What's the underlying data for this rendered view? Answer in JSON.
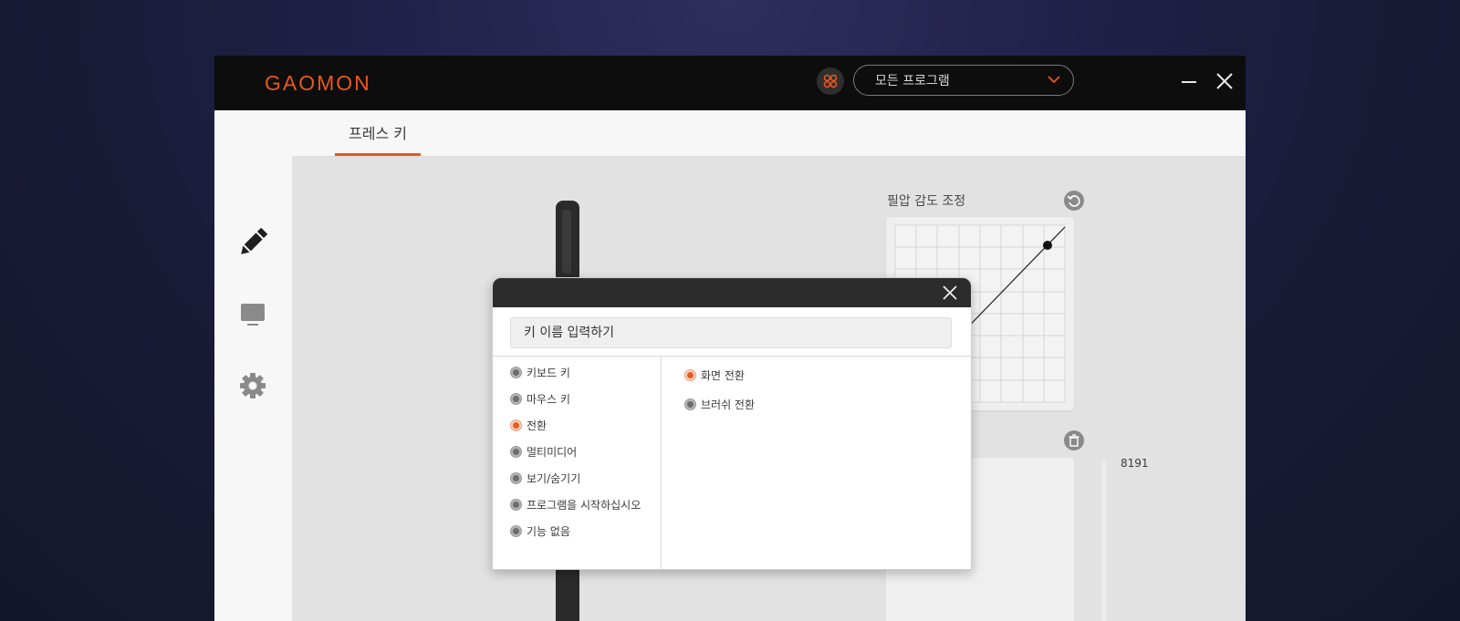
{
  "app": {
    "logo_text": "GAOMON",
    "program_select": "모든 프로그램",
    "accent_color": "#e8581c"
  },
  "tabs": [
    {
      "label": "프레스 키",
      "active": true
    }
  ],
  "sidebar": [
    {
      "icon": "pen-icon",
      "active": true
    },
    {
      "icon": "monitor-icon",
      "active": false
    },
    {
      "icon": "gear-icon",
      "active": false
    }
  ],
  "pressure": {
    "title": "필압 감도 조정",
    "max_value": "8191"
  },
  "dialog": {
    "input_placeholder": "키 이름 입력하기",
    "categories": [
      {
        "label": "키보드 키",
        "selected": false
      },
      {
        "label": "마우스 키",
        "selected": false
      },
      {
        "label": "전환",
        "selected": true
      },
      {
        "label": "멀티미디어",
        "selected": false
      },
      {
        "label": "보기/숨기기",
        "selected": false
      },
      {
        "label": "프로그램을 시작하십시오",
        "selected": false
      },
      {
        "label": "기능 없음",
        "selected": false
      }
    ],
    "options": [
      {
        "label": "화면 전환",
        "selected": true
      },
      {
        "label": "브러쉬 전환",
        "selected": false
      }
    ]
  }
}
